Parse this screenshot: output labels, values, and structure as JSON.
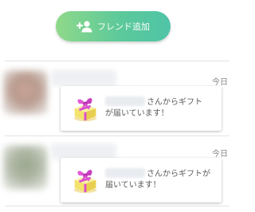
{
  "header": {
    "add_friend_label": "フレンド追加"
  },
  "feed": {
    "items": [
      {
        "time": "今日",
        "message_line1": "さんからギフト",
        "message_line2": "が届いています！"
      },
      {
        "time": "今日",
        "message_line1": "さんからギフトが",
        "message_line2": "届いています！"
      }
    ]
  },
  "colors": {
    "button_gradient_start": "#8fd98a",
    "button_gradient_end": "#4fc4a7",
    "gift_wrap": "#f4e36b",
    "gift_ribbon": "#d94fd0"
  }
}
